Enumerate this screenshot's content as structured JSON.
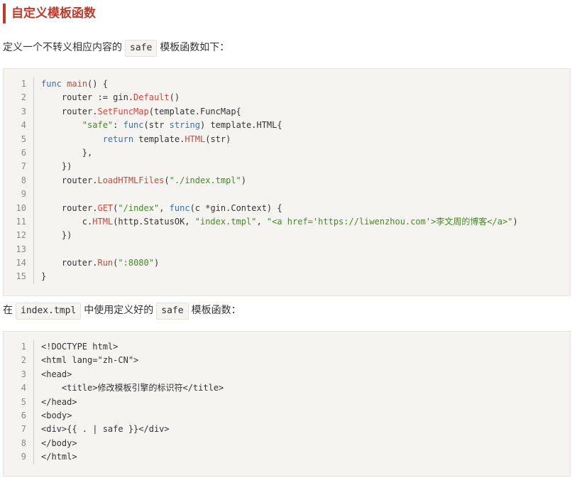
{
  "heading": "自定义模板函数",
  "para1": {
    "before": "定义一个不转义相应内容的",
    "code": "safe",
    "after": "模板函数如下："
  },
  "code1": [
    [
      {
        "t": "kw",
        "v": "func"
      },
      {
        "t": "",
        "v": " "
      },
      {
        "t": "fn",
        "v": "main"
      },
      {
        "t": "",
        "v": "() {"
      }
    ],
    [
      {
        "t": "",
        "v": "    router := gin."
      },
      {
        "t": "fn",
        "v": "Default"
      },
      {
        "t": "",
        "v": "()"
      }
    ],
    [
      {
        "t": "",
        "v": "    router."
      },
      {
        "t": "fn",
        "v": "SetFuncMap"
      },
      {
        "t": "",
        "v": "(template.FuncMap{"
      }
    ],
    [
      {
        "t": "",
        "v": "        "
      },
      {
        "t": "str",
        "v": "\"safe\""
      },
      {
        "t": "",
        "v": ": "
      },
      {
        "t": "kw",
        "v": "func"
      },
      {
        "t": "",
        "v": "(str "
      },
      {
        "t": "kw",
        "v": "string"
      },
      {
        "t": "",
        "v": ") template.HTML{"
      }
    ],
    [
      {
        "t": "",
        "v": "            "
      },
      {
        "t": "kw",
        "v": "return"
      },
      {
        "t": "",
        "v": " template."
      },
      {
        "t": "fn",
        "v": "HTML"
      },
      {
        "t": "",
        "v": "(str)"
      }
    ],
    [
      {
        "t": "",
        "v": "        },"
      }
    ],
    [
      {
        "t": "",
        "v": "    })"
      }
    ],
    [
      {
        "t": "",
        "v": "    router."
      },
      {
        "t": "fn",
        "v": "LoadHTMLFiles"
      },
      {
        "t": "",
        "v": "("
      },
      {
        "t": "str",
        "v": "\"./index.tmpl\""
      },
      {
        "t": "",
        "v": ")"
      }
    ],
    [
      {
        "t": "",
        "v": ""
      }
    ],
    [
      {
        "t": "",
        "v": "    router."
      },
      {
        "t": "fn",
        "v": "GET"
      },
      {
        "t": "",
        "v": "("
      },
      {
        "t": "str",
        "v": "\"/index\""
      },
      {
        "t": "",
        "v": ", "
      },
      {
        "t": "kw",
        "v": "func"
      },
      {
        "t": "",
        "v": "(c *gin.Context) {"
      }
    ],
    [
      {
        "t": "",
        "v": "        c."
      },
      {
        "t": "fn",
        "v": "HTML"
      },
      {
        "t": "",
        "v": "(http.StatusOK, "
      },
      {
        "t": "str",
        "v": "\"index.tmpl\""
      },
      {
        "t": "",
        "v": ", "
      },
      {
        "t": "str",
        "v": "\"<a href='https://liwenzhou.com'>李文周的博客</a>\""
      },
      {
        "t": "",
        "v": ")"
      }
    ],
    [
      {
        "t": "",
        "v": "    })"
      }
    ],
    [
      {
        "t": "",
        "v": ""
      }
    ],
    [
      {
        "t": "",
        "v": "    router."
      },
      {
        "t": "fn",
        "v": "Run"
      },
      {
        "t": "",
        "v": "("
      },
      {
        "t": "str",
        "v": "\":8080\""
      },
      {
        "t": "",
        "v": ")"
      }
    ],
    [
      {
        "t": "",
        "v": "}"
      }
    ]
  ],
  "para2": {
    "before": "在",
    "code1": "index.tmpl",
    "middle": "中使用定义好的",
    "code2": "safe",
    "after": "模板函数："
  },
  "code2": [
    [
      {
        "t": "",
        "v": "<!DOCTYPE html>"
      }
    ],
    [
      {
        "t": "",
        "v": "<html lang=\"zh-CN\">"
      }
    ],
    [
      {
        "t": "",
        "v": "<head>"
      }
    ],
    [
      {
        "t": "",
        "v": "    <title>修改模板引擎的标识符</title>"
      }
    ],
    [
      {
        "t": "",
        "v": "</head>"
      }
    ],
    [
      {
        "t": "",
        "v": "<body>"
      }
    ],
    [
      {
        "t": "",
        "v": "<div>{{ . | safe }}</div>"
      }
    ],
    [
      {
        "t": "",
        "v": "</body>"
      }
    ],
    [
      {
        "t": "",
        "v": "</html>"
      }
    ]
  ]
}
